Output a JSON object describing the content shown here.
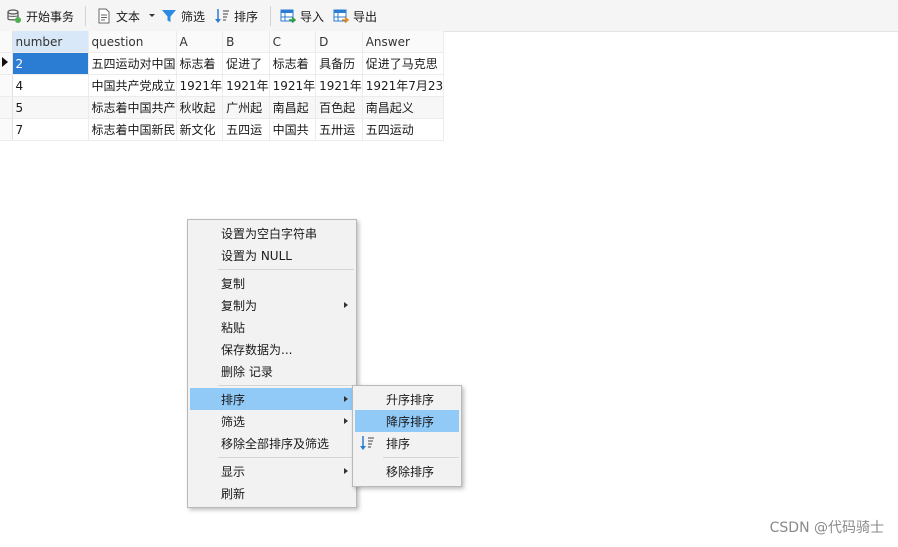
{
  "toolbar": {
    "begin_transaction": "开始事务",
    "text": "文本",
    "filter": "筛选",
    "sort": "排序",
    "import": "导入",
    "export": "导出"
  },
  "table": {
    "columns": [
      "number",
      "question",
      "A",
      "B",
      "C",
      "D",
      "Answer"
    ],
    "rows": [
      [
        "2",
        "五四运动对中国",
        "标志着",
        "促进了",
        "标志着",
        "具备历",
        "促进了马克思"
      ],
      [
        "4",
        "中国共产党成立",
        "1921年",
        "1921年",
        "1921年",
        "1921年",
        "1921年7月23"
      ],
      [
        "5",
        "标志着中国共产",
        "秋收起",
        "广州起",
        "南昌起",
        "百色起",
        "南昌起义"
      ],
      [
        "7",
        "标志着中国新民",
        "新文化",
        "五四运",
        "中国共",
        "五卅运",
        "五四运动"
      ]
    ]
  },
  "context_menu": {
    "set_empty_string": "设置为空白字符串",
    "set_null": "设置为 NULL",
    "copy": "复制",
    "copy_as": "复制为",
    "paste": "粘贴",
    "save_data_as": "保存数据为...",
    "delete_record": "删除 记录",
    "sort": "排序",
    "filter": "筛选",
    "remove_all_sort_filter": "移除全部排序及筛选",
    "display": "显示",
    "refresh": "刷新"
  },
  "sort_submenu": {
    "ascending": "升序排序",
    "descending": "降序排序",
    "sort": "排序",
    "remove_sort": "移除排序"
  },
  "watermark": "CSDN @代码骑士",
  "colors": {
    "selection": "#2b7cd3",
    "menu_highlight": "#91c9f7",
    "filter_icon": "#2b8be0"
  }
}
